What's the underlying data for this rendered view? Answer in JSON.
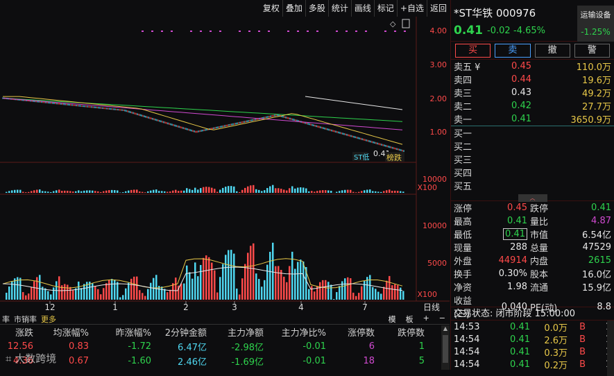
{
  "toolbar": [
    "复权",
    "叠加",
    "多股",
    "统计",
    "画线",
    "标记",
    "+自选",
    "返回"
  ],
  "chart": {
    "price_ticks": [
      "4.00",
      "3.00",
      "2.00",
      "1.00"
    ],
    "vol_ticks": [
      "10000",
      "X100"
    ],
    "sub_ticks": [
      "10000",
      "5000",
      "X100"
    ],
    "x_ticks": [
      "12",
      "1",
      "2",
      "3",
      "4",
      "7"
    ],
    "x_unit": "日线",
    "last_price_label": "0.41",
    "badge_low": "ST低",
    "badge_label": "榜跌"
  },
  "colors": {
    "up": "#ff4a4a",
    "down": "#2ed34d",
    "vol_down": "#4fd7f0",
    "ma1": "#e8e8e8",
    "ma2": "#e8c848",
    "ma3": "#d04ad0",
    "ma4": "#2ed34d"
  },
  "bottom": {
    "tabs": [
      "率",
      "市销率",
      "更多"
    ],
    "board_btns": [
      "模",
      "板",
      "+",
      "−"
    ],
    "columns": [
      "涨跌",
      "均涨幅%",
      "昨涨幅%",
      "2分钟金额",
      "主力净额",
      "主力净比%",
      "涨停数",
      "跌停数"
    ],
    "rows": [
      [
        "12.56",
        "0.83",
        "-1.72",
        "6.47亿",
        "-2.98亿",
        "-0.01",
        "6",
        "1"
      ],
      [
        "4.36",
        "0.67",
        "-1.60",
        "2.46亿",
        "-1.69亿",
        "-0.01",
        "18",
        "5"
      ]
    ],
    "watermark": "大数跨境"
  },
  "stock": {
    "name": "*ST华铁",
    "code": "000976",
    "price": "0.41",
    "change": "-0.02",
    "pct": "-4.65%",
    "sector_name": "运输设备",
    "sector_pct": "-1.25%"
  },
  "actions": [
    "买",
    "卖",
    "撤",
    "警"
  ],
  "orderbook": {
    "asks": [
      [
        "卖五 ¥",
        "0.45",
        "110.0万"
      ],
      [
        "卖四",
        "0.44",
        "19.6万"
      ],
      [
        "卖三",
        "0.43",
        "49.2万"
      ],
      [
        "卖二",
        "0.42",
        "27.7万"
      ],
      [
        "卖一",
        "0.41",
        "3650.9万"
      ]
    ],
    "bids": [
      [
        "买一",
        "",
        ""
      ],
      [
        "买二",
        "",
        ""
      ],
      [
        "买三",
        "",
        ""
      ],
      [
        "买四",
        "",
        ""
      ],
      [
        "买五",
        "",
        ""
      ]
    ]
  },
  "stats": [
    [
      "涨停",
      "0.45",
      "跌停",
      "0.41"
    ],
    [
      "最高",
      "0.41",
      "量比",
      "4.87"
    ],
    [
      "最低",
      "0.41",
      "市值",
      "6.54亿"
    ],
    [
      "现量",
      "288",
      "总量",
      "47529"
    ],
    [
      "外盘",
      "44914",
      "内盘",
      "2615"
    ],
    [
      "换手",
      "0.30%",
      "股本",
      "16.0亿"
    ],
    [
      "净资",
      "1.98",
      "流通",
      "15.9亿"
    ],
    [
      "收益(三)",
      "0.040",
      "PE(动)",
      "8.8"
    ]
  ],
  "trade_status": "交易状态: 闭市阶段 15:00:00",
  "trades": [
    [
      "14:53",
      "0.41",
      "0.0万",
      "B",
      "1"
    ],
    [
      "14:54",
      "0.41",
      "2.6万",
      "B",
      "1"
    ],
    [
      "14:54",
      "0.41",
      "0.3万",
      "B",
      "1"
    ],
    [
      "14:54",
      "0.41",
      "0.2万",
      "B",
      "1"
    ]
  ]
}
